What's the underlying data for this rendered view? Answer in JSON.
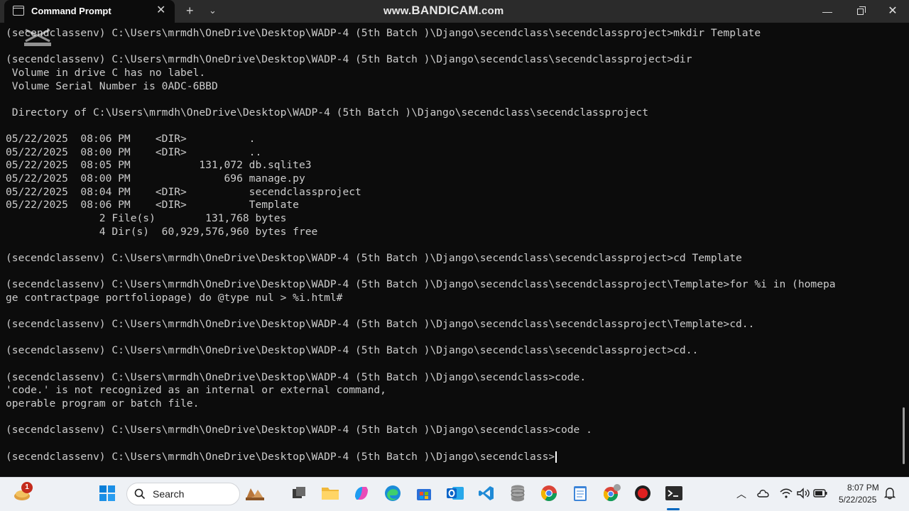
{
  "window": {
    "tab_title": "Command Prompt",
    "tab_close": "✕",
    "new_tab": "+",
    "tab_dropdown": "⌄",
    "watermark_prefix": "www.",
    "watermark_brand": "BANDICAM",
    "watermark_suffix": ".com",
    "minimize": "—",
    "close": "✕"
  },
  "terminal": {
    "lines": [
      "(secendclassenv) C:\\Users\\mrmdh\\OneDrive\\Desktop\\WADP-4 (5th Batch )\\Django\\secendclass\\secendclassproject>mkdir Template",
      "",
      "(secendclassenv) C:\\Users\\mrmdh\\OneDrive\\Desktop\\WADP-4 (5th Batch )\\Django\\secendclass\\secendclassproject>dir",
      " Volume in drive C has no label.",
      " Volume Serial Number is 0ADC-6BBD",
      "",
      " Directory of C:\\Users\\mrmdh\\OneDrive\\Desktop\\WADP-4 (5th Batch )\\Django\\secendclass\\secendclassproject",
      "",
      "05/22/2025  08:06 PM    <DIR>          .",
      "05/22/2025  08:00 PM    <DIR>          ..",
      "05/22/2025  08:05 PM           131,072 db.sqlite3",
      "05/22/2025  08:00 PM               696 manage.py",
      "05/22/2025  08:04 PM    <DIR>          secendclassproject",
      "05/22/2025  08:06 PM    <DIR>          Template",
      "               2 File(s)        131,768 bytes",
      "               4 Dir(s)  60,929,576,960 bytes free",
      "",
      "(secendclassenv) C:\\Users\\mrmdh\\OneDrive\\Desktop\\WADP-4 (5th Batch )\\Django\\secendclass\\secendclassproject>cd Template",
      "",
      "(secendclassenv) C:\\Users\\mrmdh\\OneDrive\\Desktop\\WADP-4 (5th Batch )\\Django\\secendclass\\secendclassproject\\Template>for %i in (homepa",
      "ge contractpage portfoliopage) do @type nul > %i.html#",
      "",
      "(secendclassenv) C:\\Users\\mrmdh\\OneDrive\\Desktop\\WADP-4 (5th Batch )\\Django\\secendclass\\secendclassproject\\Template>cd..",
      "",
      "(secendclassenv) C:\\Users\\mrmdh\\OneDrive\\Desktop\\WADP-4 (5th Batch )\\Django\\secendclass\\secendclassproject>cd..",
      "",
      "(secendclassenv) C:\\Users\\mrmdh\\OneDrive\\Desktop\\WADP-4 (5th Batch )\\Django\\secendclass>code.",
      "'code.' is not recognized as an internal or external command,",
      "operable program or batch file.",
      "",
      "(secendclassenv) C:\\Users\\mrmdh\\OneDrive\\Desktop\\WADP-4 (5th Batch )\\Django\\secendclass>code .",
      "",
      "(secendclassenv) C:\\Users\\mrmdh\\OneDrive\\Desktop\\WADP-4 (5th Batch )\\Django\\secendclass>"
    ]
  },
  "taskbar": {
    "widgets_badge": "1",
    "search_placeholder": "Search",
    "time": "8:07 PM",
    "date": "5/22/2025",
    "chevron": "︿",
    "icons": [
      "widgets-icon",
      "start-icon",
      "search-icon",
      "task-view-icon",
      "file-explorer-icon",
      "copilot-icon",
      "edge-icon",
      "store-icon",
      "outlook-icon",
      "vscode-icon",
      "database-icon",
      "chrome-icon",
      "notepad-icon",
      "chrome-profile-icon",
      "recorder-icon",
      "terminal-icon"
    ]
  },
  "colors": {
    "terminal_bg": "#0c0c0c",
    "terminal_text": "#cccccc",
    "titlebar_bg": "#2b2b2b",
    "taskbar_bg": "#eef1f5",
    "accent": "#0067c0"
  }
}
